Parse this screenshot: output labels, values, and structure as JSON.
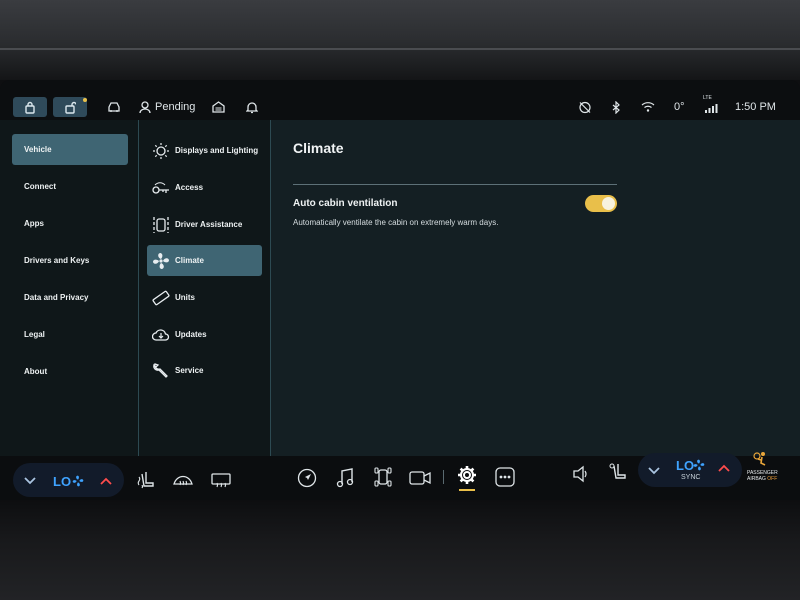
{
  "status_bar": {
    "profile_label": "Pending",
    "temperature": "0°",
    "signal_label": "LTE",
    "time": "1:50 PM"
  },
  "nav_primary": [
    {
      "label": "Vehicle",
      "active": true
    },
    {
      "label": "Connect",
      "active": false
    },
    {
      "label": "Apps",
      "active": false
    },
    {
      "label": "Drivers and Keys",
      "active": false
    },
    {
      "label": "Data and Privacy",
      "active": false
    },
    {
      "label": "Legal",
      "active": false
    },
    {
      "label": "About",
      "active": false
    }
  ],
  "nav_secondary": [
    {
      "label": "Displays and Lighting",
      "icon": "light-bulb-icon",
      "active": false
    },
    {
      "label": "Access",
      "icon": "key-icon",
      "active": false
    },
    {
      "label": "Driver Assistance",
      "icon": "driver-assist-icon",
      "active": false
    },
    {
      "label": "Climate",
      "icon": "fan-icon",
      "active": true
    },
    {
      "label": "Units",
      "icon": "ruler-icon",
      "active": false
    },
    {
      "label": "Updates",
      "icon": "cloud-download-icon",
      "active": false
    },
    {
      "label": "Service",
      "icon": "wrench-icon",
      "active": false
    }
  ],
  "main": {
    "title": "Climate",
    "setting": {
      "label": "Auto cabin ventilation",
      "description": "Automatically ventilate the cabin on extremely warm days.",
      "enabled": true
    }
  },
  "dock": {
    "driver_temp": "LO",
    "passenger_temp": "LO",
    "passenger_sync_label": "SYNC",
    "airbag_label_line1": "PASSENGER",
    "airbag_label_line2": "AIRBAG",
    "airbag_state": "OFF"
  },
  "colors": {
    "accent": "#3f6573",
    "toggle_on": "#e9bf4a",
    "temp_blue": "#3fa3ff",
    "up_arrow_red": "#ff4d4d"
  }
}
